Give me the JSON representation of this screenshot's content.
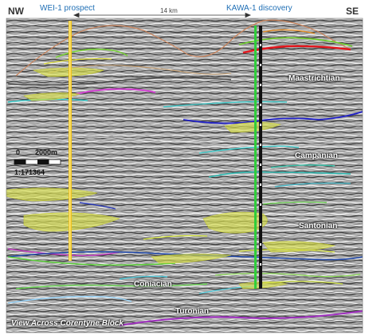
{
  "header": {
    "left_corner": "NW",
    "right_corner": "SE",
    "left_well": "WEI-1 prospect",
    "right_well": "KAWA-1 discovery",
    "distance": "14 km"
  },
  "stages": {
    "maastrichtian": "Maastrichtian",
    "campanian": "Campanian",
    "santonian": "Santonian",
    "coniacian": "Coniacian",
    "turonian": "Turonian"
  },
  "scale_bar": {
    "zero": "0",
    "length": "2000m",
    "ratio": "1:171364"
  },
  "caption": "View Across Corentyne Block",
  "colors": {
    "well_label": "#1f6fb5",
    "wei_well": "#f0c21c",
    "kawa_well": "#111111",
    "kawa_log": "#2fcf3a",
    "reservoir_fill": "#d9e04a"
  }
}
